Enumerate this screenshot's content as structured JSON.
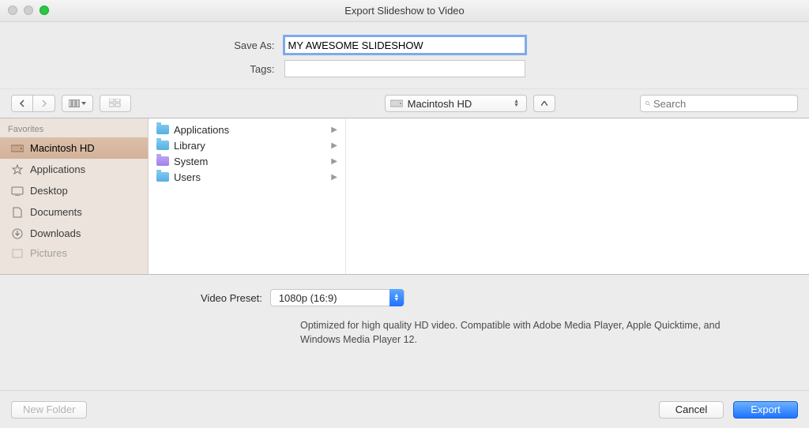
{
  "window": {
    "title": "Export Slideshow to Video"
  },
  "form": {
    "save_as_label": "Save As:",
    "save_as_value": "MY AWESOME SLIDESHOW",
    "tags_label": "Tags:",
    "tags_value": ""
  },
  "toolbar": {
    "location_name": "Macintosh HD",
    "search_placeholder": "Search"
  },
  "sidebar": {
    "header": "Favorites",
    "items": [
      {
        "label": "Macintosh HD",
        "icon": "hdd"
      },
      {
        "label": "Applications",
        "icon": "apps"
      },
      {
        "label": "Desktop",
        "icon": "desktop"
      },
      {
        "label": "Documents",
        "icon": "docs"
      },
      {
        "label": "Downloads",
        "icon": "downloads"
      },
      {
        "label": "Pictures",
        "icon": "pictures"
      }
    ]
  },
  "column": {
    "items": [
      {
        "label": "Applications"
      },
      {
        "label": "Library"
      },
      {
        "label": "System"
      },
      {
        "label": "Users"
      }
    ]
  },
  "preset": {
    "label": "Video Preset:",
    "value": "1080p (16:9)",
    "description": "Optimized for high quality HD video. Compatible with Adobe Media Player, Apple Quicktime, and Windows Media Player 12."
  },
  "footer": {
    "new_folder": "New Folder",
    "cancel": "Cancel",
    "export": "Export"
  }
}
